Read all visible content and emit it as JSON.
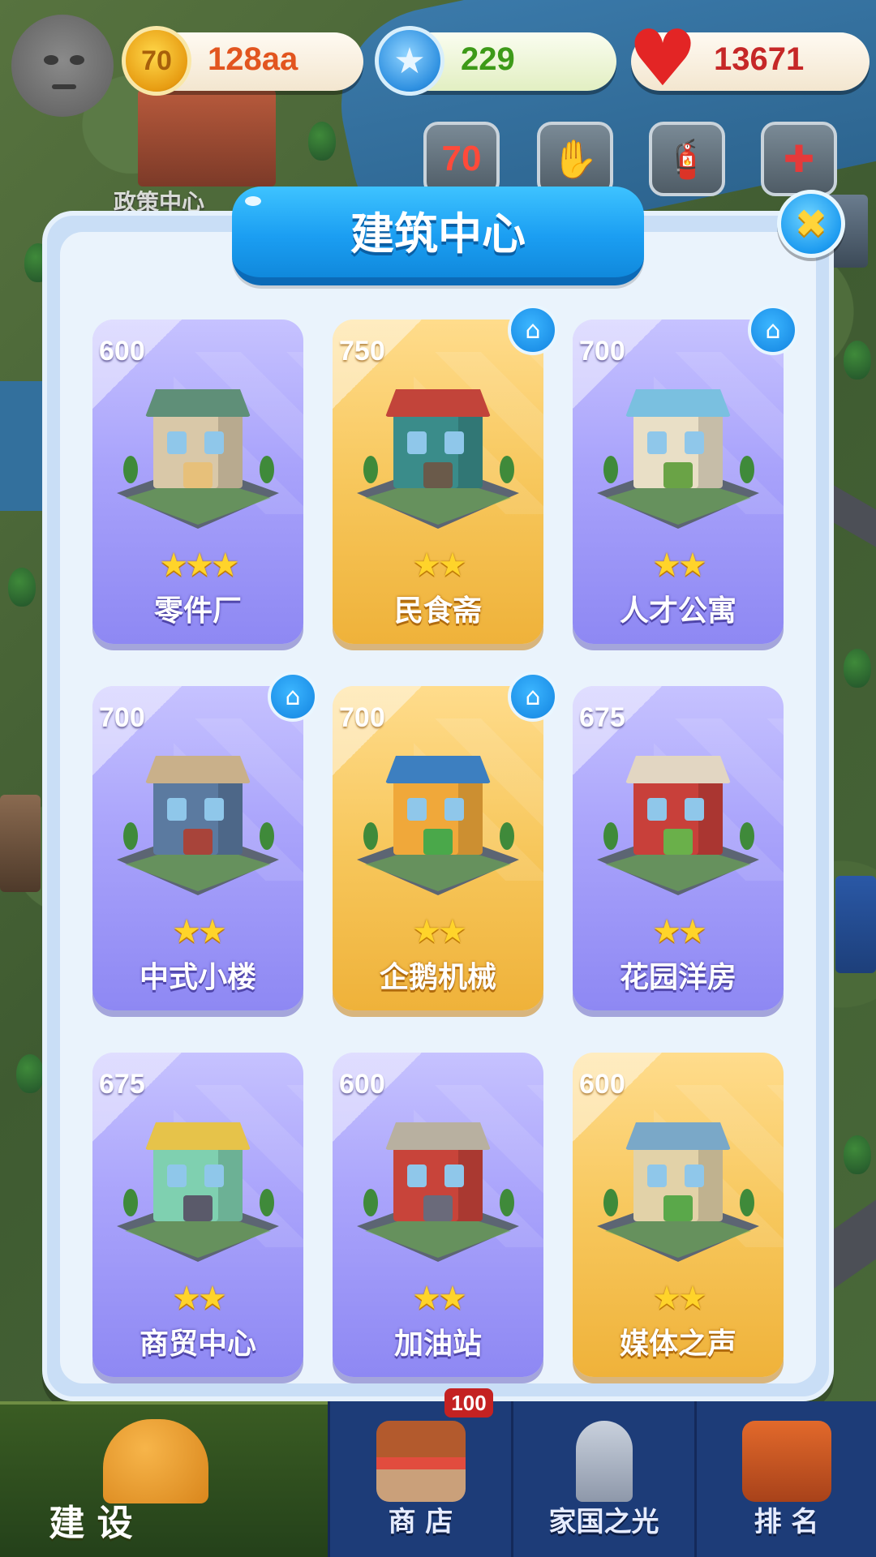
{
  "hud": {
    "coins": "128aa",
    "gems": "229",
    "hearts": "13671",
    "coin_icon": "coin-70-icon",
    "gem_icon": "blue-star-gem-icon",
    "heart_icon": "heart-icon",
    "policy_center_label": "政策中心",
    "top_buttons": [
      "event-70-icon",
      "handshake-icon",
      "fire-extinguisher-icon",
      "medical-kit-icon"
    ],
    "top_button_glyphs": [
      "70",
      "✋",
      "🧯",
      "✚"
    ]
  },
  "dialog": {
    "title": "建筑中心",
    "close_glyph": "✖",
    "home_glyph": "⌂",
    "star_glyph": "★",
    "cards": [
      {
        "price": "600",
        "stars": 3,
        "name": "零件厂",
        "theme": "purple",
        "home": false
      },
      {
        "price": "750",
        "stars": 2,
        "name": "民食斋",
        "theme": "gold",
        "home": true
      },
      {
        "price": "700",
        "stars": 2,
        "name": "人才公寓",
        "theme": "purple",
        "home": true
      },
      {
        "price": "700",
        "stars": 2,
        "name": "中式小楼",
        "theme": "purple",
        "home": true
      },
      {
        "price": "700",
        "stars": 2,
        "name": "企鹅机械",
        "theme": "gold",
        "home": true
      },
      {
        "price": "675",
        "stars": 2,
        "name": "花园洋房",
        "theme": "purple",
        "home": false
      },
      {
        "price": "675",
        "stars": 2,
        "name": "商贸中心",
        "theme": "purple",
        "home": false
      },
      {
        "price": "600",
        "stars": 2,
        "name": "加油站",
        "theme": "purple",
        "home": false
      },
      {
        "price": "600",
        "stars": 2,
        "name": "媒体之声",
        "theme": "gold",
        "home": false
      }
    ]
  },
  "bottom_nav": {
    "tabs": [
      {
        "label": "建 设",
        "icon": "hard-hat-icon",
        "active": true
      },
      {
        "label": "商 店",
        "icon": "shop-icon",
        "active": false
      },
      {
        "label": "家国之光",
        "icon": "rocket-icon",
        "active": false
      },
      {
        "label": "排 名",
        "icon": "podium-icon",
        "active": false
      }
    ],
    "shop_badge": "100"
  },
  "colors": {
    "card_purple": "#a9a3fb",
    "card_gold": "#f7c75c",
    "title_blue": "#1b9ef2",
    "star_yellow": "#ffd42a"
  }
}
